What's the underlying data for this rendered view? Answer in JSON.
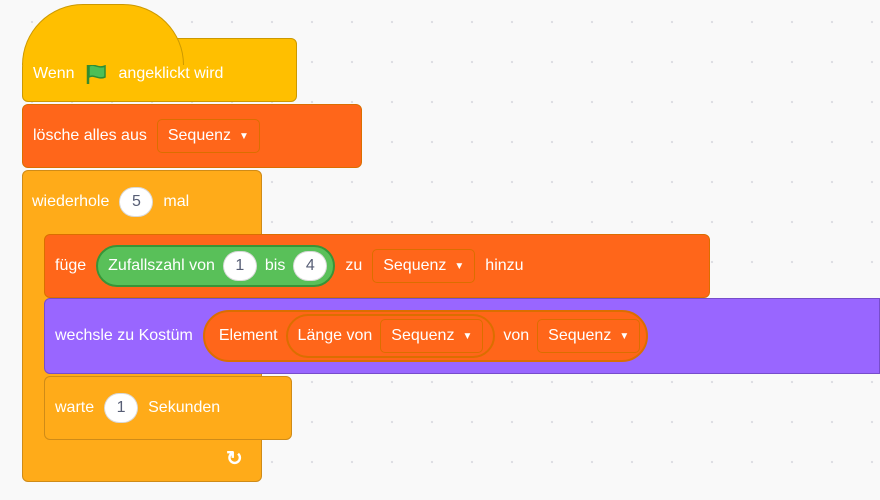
{
  "hat": {
    "prefix": "Wenn",
    "suffix": "angeklickt wird"
  },
  "clear": {
    "label": "lösche alles aus",
    "list": "Sequenz"
  },
  "repeat": {
    "label_pre": "wiederhole",
    "count": "5",
    "label_post": "mal"
  },
  "add": {
    "label_pre": "füge",
    "random_label": "Zufallszahl von",
    "from": "1",
    "to_label": "bis",
    "to": "4",
    "zu_label": "zu",
    "list": "Sequenz",
    "suffix": "hinzu"
  },
  "switch": {
    "label": "wechsle zu Kostüm",
    "item_label": "Element",
    "length_label": "Länge von",
    "length_list": "Sequenz",
    "von_label": "von",
    "list": "Sequenz"
  },
  "wait": {
    "label_pre": "warte",
    "seconds": "1",
    "label_post": "Sekunden"
  },
  "colors": {
    "events": "#ffbf00",
    "control": "#ffab19",
    "variables": "#ff661a",
    "looks": "#9966ff",
    "operators": "#59c059"
  },
  "icons": {
    "flag": "green-flag-icon",
    "loop": "loop-arrow-icon",
    "dropdown": "caret-down-icon"
  }
}
